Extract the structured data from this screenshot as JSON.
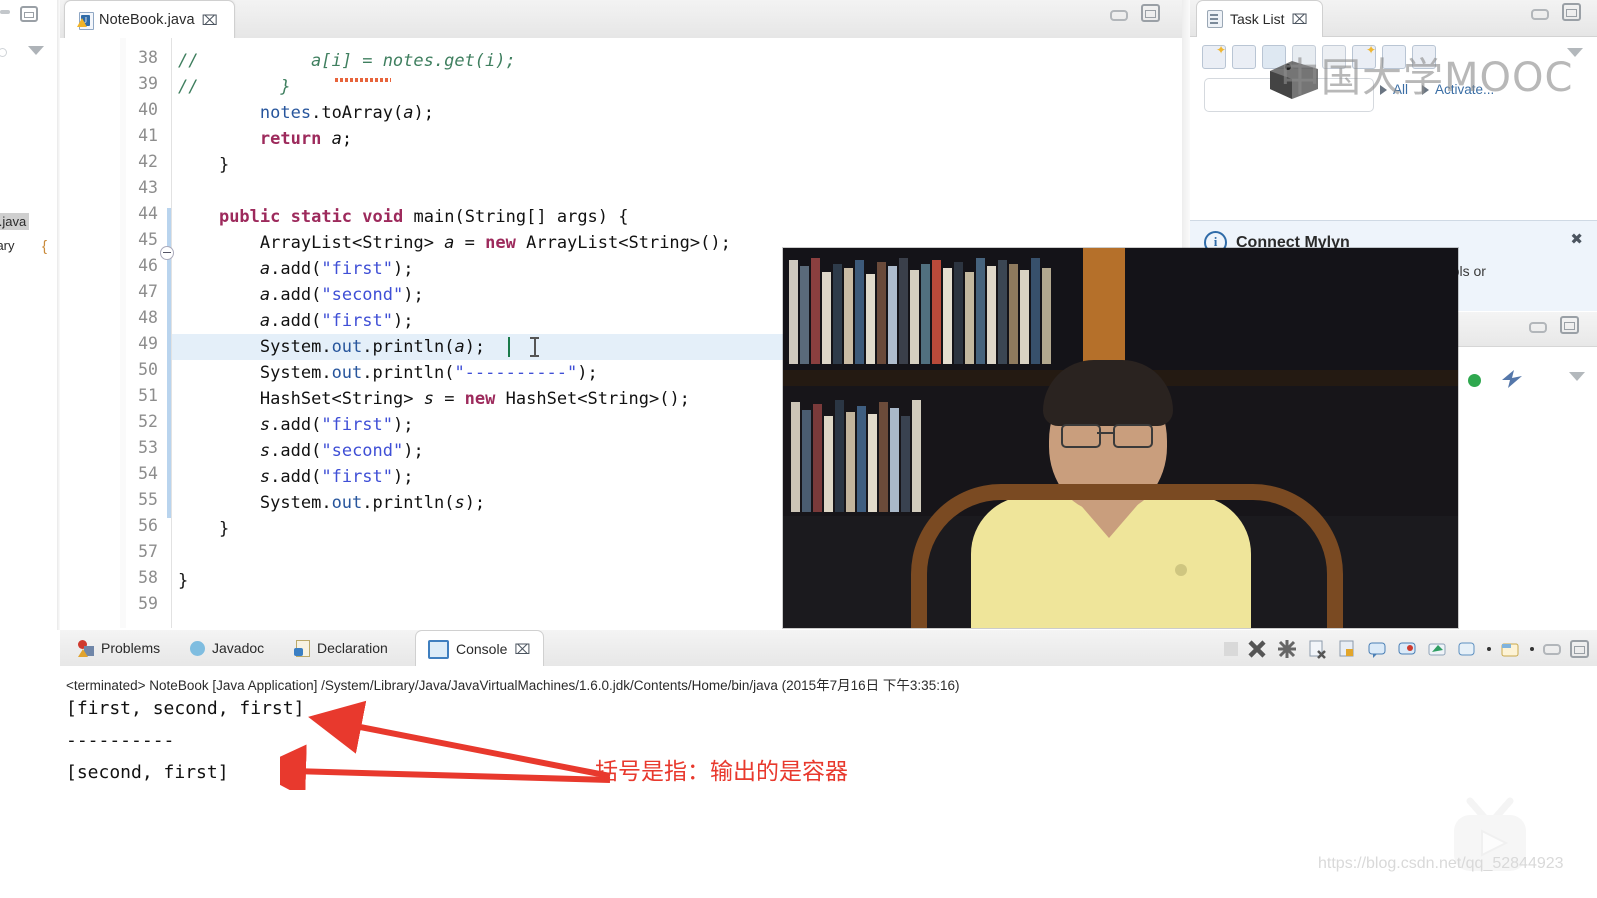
{
  "left_strip": {
    "tree_items": [
      {
        "label": "ok.java",
        "selected": true
      },
      {
        "label": "ibrary",
        "selected": false
      }
    ],
    "restore_icon": "restore-icon",
    "collapse_icon": "chevron-down-icon"
  },
  "editor": {
    "tab_title": "NoteBook.java",
    "tab_close": "⌧",
    "file_icon": "java-file-icon",
    "minimize_icon": "minimize-icon",
    "maximize_icon": "maximize-icon",
    "highlighted_line": 49,
    "lines": [
      {
        "n": 38,
        "text": "//           a[i] = notes.get(i);",
        "kind": "comment"
      },
      {
        "n": 39,
        "text": "//        }",
        "kind": "comment"
      },
      {
        "n": 40,
        "text": "        notes.toArray(a);",
        "kind": "code"
      },
      {
        "n": 41,
        "text": "        return a;",
        "kind": "code"
      },
      {
        "n": 42,
        "text": "    }",
        "kind": "code"
      },
      {
        "n": 43,
        "text": "",
        "kind": "code"
      },
      {
        "n": 44,
        "text": "    public static void main(String[] args) {",
        "kind": "code"
      },
      {
        "n": 45,
        "text": "        ArrayList<String> a = new ArrayList<String>();",
        "kind": "code"
      },
      {
        "n": 46,
        "text": "        a.add(\"first\");",
        "kind": "code"
      },
      {
        "n": 47,
        "text": "        a.add(\"second\");",
        "kind": "code"
      },
      {
        "n": 48,
        "text": "        a.add(\"first\");",
        "kind": "code"
      },
      {
        "n": 49,
        "text": "        System.out.println(a);",
        "kind": "code"
      },
      {
        "n": 50,
        "text": "        System.out.println(\"----------\");",
        "kind": "code"
      },
      {
        "n": 51,
        "text": "        HashSet<String> s = new HashSet<String>();",
        "kind": "code"
      },
      {
        "n": 52,
        "text": "        s.add(\"first\");",
        "kind": "code"
      },
      {
        "n": 53,
        "text": "        s.add(\"second\");",
        "kind": "code"
      },
      {
        "n": 54,
        "text": "        s.add(\"first\");",
        "kind": "code"
      },
      {
        "n": 55,
        "text": "        System.out.println(s);",
        "kind": "code"
      },
      {
        "n": 56,
        "text": "    }",
        "kind": "code"
      },
      {
        "n": 57,
        "text": "",
        "kind": "code"
      },
      {
        "n": 58,
        "text": "}",
        "kind": "code"
      },
      {
        "n": 59,
        "text": "",
        "kind": "code"
      }
    ]
  },
  "task_list": {
    "tab_title": "Task List",
    "tab_close": "⌧",
    "tab_icon": "task-list-icon",
    "minimize_icon": "minimize-icon",
    "maximize_icon": "maximize-icon",
    "view_menu_icon": "chevron-down-icon",
    "filter_placeholder": "",
    "filter_value": "",
    "all_label": "All",
    "activate_label": "Activate...",
    "toolbar_icons": [
      "new-task-icon",
      "search-task-icon",
      "synchronize-icon",
      "group-by-icon",
      "filter-icon",
      "focus-icon",
      "collapse-all-icon",
      "link-icon"
    ]
  },
  "watermark_mooc": "中国大学MOOC",
  "mylyn": {
    "title": "Connect Mylyn",
    "info_icon": "info-icon",
    "close_icon": "close-icon",
    "body_text": "tools or"
  },
  "lower_right": {
    "minimize_icon": "minimize-icon",
    "maximize_icon": "maximize-icon",
    "view_menu_icon": "chevron-down-icon",
    "status_dot_color": "#2fa84f"
  },
  "console": {
    "tabs": [
      {
        "label": "Problems",
        "icon": "problems-icon",
        "active": false,
        "closable": false
      },
      {
        "label": "Javadoc",
        "icon": "javadoc-icon",
        "active": false,
        "closable": false
      },
      {
        "label": "Declaration",
        "icon": "declaration-icon",
        "active": false,
        "closable": false
      },
      {
        "label": "Console",
        "icon": "console-icon",
        "active": true,
        "closable": true
      }
    ],
    "tab_close": "⌧",
    "launch_header": "<terminated> NoteBook [Java Application] /System/Library/Java/JavaVirtualMachines/1.6.0.jdk/Contents/Home/bin/java (2015年7月16日 下午3:35:16)",
    "output_lines": [
      "[first, second, first]",
      "----------",
      "[second, first]"
    ],
    "toolbar_icons": [
      "terminate-icon",
      "remove-launch-icon",
      "remove-all-launches-icon",
      "clear-console-icon",
      "scroll-lock-icon",
      "show-console-on-output-icon",
      "show-console-on-error-icon",
      "pin-console-icon",
      "display-console-icon",
      "open-console-icon",
      "minimize-icon",
      "maximize-icon"
    ]
  },
  "annotation": {
    "text": "括号是指：输出的是容器",
    "color": "#e8392d",
    "arrow_count": 2
  },
  "watermark_csdn": "https://blog.csdn.net/qq_52844923",
  "colors": {
    "keyword": "#9d2a5c",
    "string": "#3f4fd6",
    "comment": "#3f7f5f",
    "field": "#27559c",
    "selection": "#dbe9f7",
    "annotation_red": "#e8392d",
    "link_blue": "#3a6ea5"
  }
}
